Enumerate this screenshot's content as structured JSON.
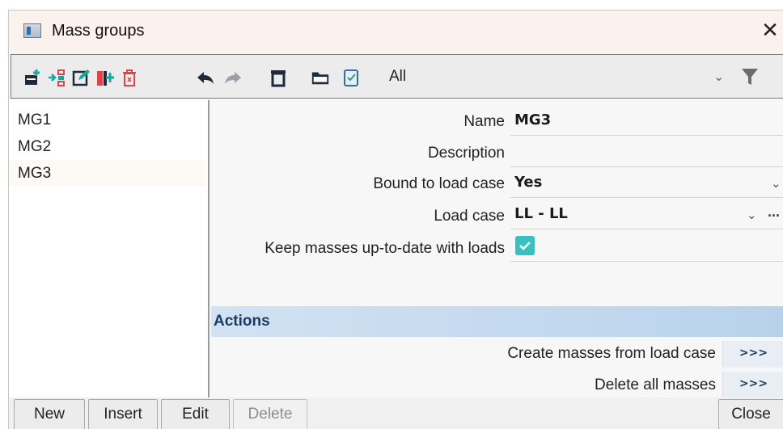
{
  "window": {
    "title": "Mass groups",
    "close_glyph": "✕"
  },
  "toolbar": {
    "icons": [
      "new-icon",
      "insert-icon",
      "edit-icon",
      "copy-icon",
      "delete-icon",
      "undo-icon",
      "redo-icon",
      "print-icon",
      "open-icon",
      "check-icon"
    ],
    "filter_value": "All",
    "filter_chevron": "⌄",
    "filter_icon": "funnel-icon"
  },
  "list": {
    "items": [
      "MG1",
      "MG2",
      "MG3"
    ],
    "selected": "MG3"
  },
  "properties": {
    "name_label": "Name",
    "name_value": "MG3",
    "description_label": "Description",
    "description_value": "",
    "bound_label": "Bound to load case",
    "bound_value": "Yes",
    "load_case_label": "Load case",
    "load_case_value": "LL - LL",
    "load_case_more": "...",
    "keep_label": "Keep masses up-to-date with loads",
    "keep_checked": true
  },
  "actions": {
    "header": "Actions",
    "items": [
      {
        "label": "Create masses from load case",
        "button": ">>>"
      },
      {
        "label": "Delete all masses",
        "button": ">>>"
      }
    ]
  },
  "buttons": {
    "new": "New",
    "insert": "Insert",
    "edit": "Edit",
    "delete": "Delete",
    "close": "Close"
  },
  "colors": {
    "accent": "#38c1c0",
    "section_header": "#1b3d63",
    "delete_red": "#e0444b",
    "toolbar_green": "#1aa59a"
  }
}
